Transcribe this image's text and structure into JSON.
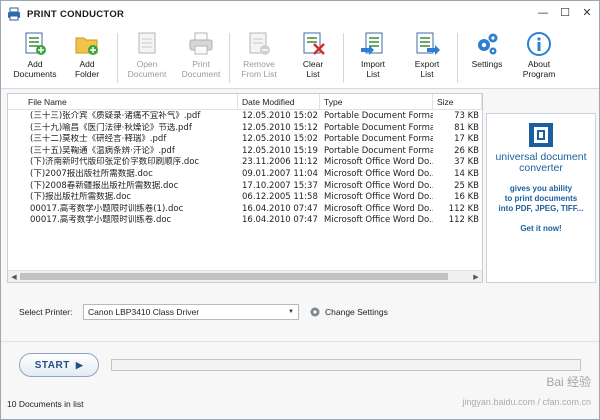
{
  "window": {
    "title": "PRINT CONDUCTOR"
  },
  "toolbar": {
    "buttons": [
      {
        "label": "Add\nDocuments",
        "icon": "add-documents-icon",
        "enabled": true
      },
      {
        "label": "Add\nFolder",
        "icon": "add-folder-icon",
        "enabled": true
      },
      {
        "label": "Open\nDocument",
        "icon": "open-document-icon",
        "enabled": false
      },
      {
        "label": "Print\nDocument",
        "icon": "print-document-icon",
        "enabled": false
      },
      {
        "label": "Remove\nFrom List",
        "icon": "remove-from-list-icon",
        "enabled": false
      },
      {
        "label": "Clear\nList",
        "icon": "clear-list-icon",
        "enabled": true
      },
      {
        "label": "Import\nList",
        "icon": "import-list-icon",
        "enabled": true
      },
      {
        "label": "Export\nList",
        "icon": "export-list-icon",
        "enabled": true
      },
      {
        "label": "Settings",
        "icon": "settings-gears-icon",
        "enabled": true
      },
      {
        "label": "About\nProgram",
        "icon": "info-icon",
        "enabled": true
      }
    ]
  },
  "table": {
    "columns": [
      "File Name",
      "Date Modified",
      "Type",
      "Size"
    ],
    "rows": [
      {
        "name": "(三十三)张介宾《质疑录·诸痛不宜补气》.pdf",
        "date": "12.05.2010 15:02",
        "type": "Portable Document Format",
        "size": "73 KB"
      },
      {
        "name": "(三十九)喻昌《医门法律·秋燥论》节选.pdf",
        "date": "12.05.2010 15:12",
        "type": "Portable Document Format",
        "size": "81 KB"
      },
      {
        "name": "(三十二)莫枚士《研经言·释瑞》.pdf",
        "date": "12.05.2010 15:02",
        "type": "Portable Document Format",
        "size": "17 KB"
      },
      {
        "name": "(三十五)吴鞠通《温病条辨·汗论》.pdf",
        "date": "12.05.2010 15:19",
        "type": "Portable Document Format",
        "size": "26 KB"
      },
      {
        "name": "(下)济南新时代版印张定价字数印刷顺序.doc",
        "date": "23.11.2006 11:12",
        "type": "Microsoft Office Word Do...",
        "size": "37 KB"
      },
      {
        "name": "(下)2007报出版社所需数据.doc",
        "date": "09.01.2007 11:04",
        "type": "Microsoft Office Word Do...",
        "size": "14 KB"
      },
      {
        "name": "(下)2008春新疆报出版社所需数据.doc",
        "date": "17.10.2007 15:37",
        "type": "Microsoft Office Word Do...",
        "size": "25 KB"
      },
      {
        "name": "(下)报出版社所需数据.doc",
        "date": "06.12.2005 11:58",
        "type": "Microsoft Office Word Do...",
        "size": "16 KB"
      },
      {
        "name": "00017.高考数学小题限时训练卷(1).doc",
        "date": "16.04.2010 07:47",
        "type": "Microsoft Office Word Do...",
        "size": "112 KB"
      },
      {
        "name": "00017.高考数学小题限时训练卷.doc",
        "date": "16.04.2010 07:47",
        "type": "Microsoft Office Word Do...",
        "size": "112 KB"
      }
    ]
  },
  "ad": {
    "brand_line1": "universal document",
    "brand_line2": "converter",
    "text_line1": "gives you ability",
    "text_line2": "to print documents",
    "text_line3": "into PDF, JPEG, TIFF...",
    "cta": "Get it now!"
  },
  "printer": {
    "label": "Select Printer:",
    "selected": "Canon LBP3410 Class Driver",
    "change_settings": "Change Settings"
  },
  "start": {
    "label": "START",
    "progress": 0
  },
  "status": {
    "text": "10 Documents in list"
  },
  "watermark": {
    "line1": "Bai 经验",
    "line2": "jingyan.baidu.com / cfan.com.cn"
  },
  "colors": {
    "accent": "#1b5f9e",
    "start_text": "#1f4f83",
    "disabled_text": "#9b9b9b"
  }
}
